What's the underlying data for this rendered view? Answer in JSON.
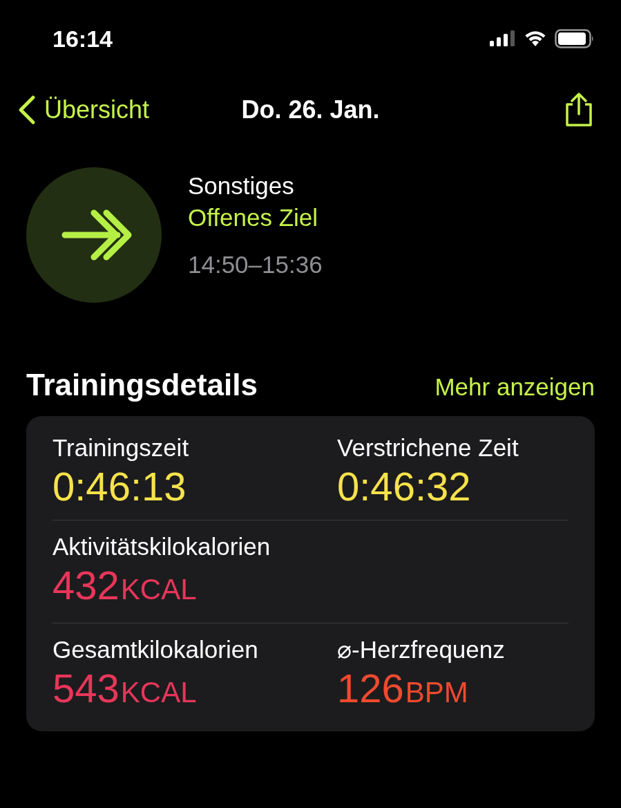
{
  "status_bar": {
    "time": "16:14"
  },
  "nav": {
    "back_label": "Übersicht",
    "title": "Do. 26. Jan."
  },
  "workout": {
    "type": "Sonstiges",
    "goal": "Offenes Ziel",
    "time_range": "14:50–15:36"
  },
  "section": {
    "title": "Trainingsdetails",
    "more_link": "Mehr anzeigen"
  },
  "metric_rows": [
    [
      {
        "label": "Trainingszeit",
        "value": "0:46:13",
        "color": "#f6e24b"
      },
      {
        "label": "Verstrichene Zeit",
        "value": "0:46:32",
        "color": "#f6e24b"
      }
    ],
    [
      {
        "label": "Aktivitätskilokalorien",
        "value": "432",
        "unit": "KCAL",
        "color": "#e8365a"
      }
    ],
    [
      {
        "label": "Gesamtkilokalorien",
        "value": "543",
        "unit": "KCAL",
        "color": "#e8365a"
      },
      {
        "label": "⌀-Herzfrequenz",
        "value": "126",
        "unit": "BPM",
        "color": "#ef4a2f"
      }
    ]
  ]
}
